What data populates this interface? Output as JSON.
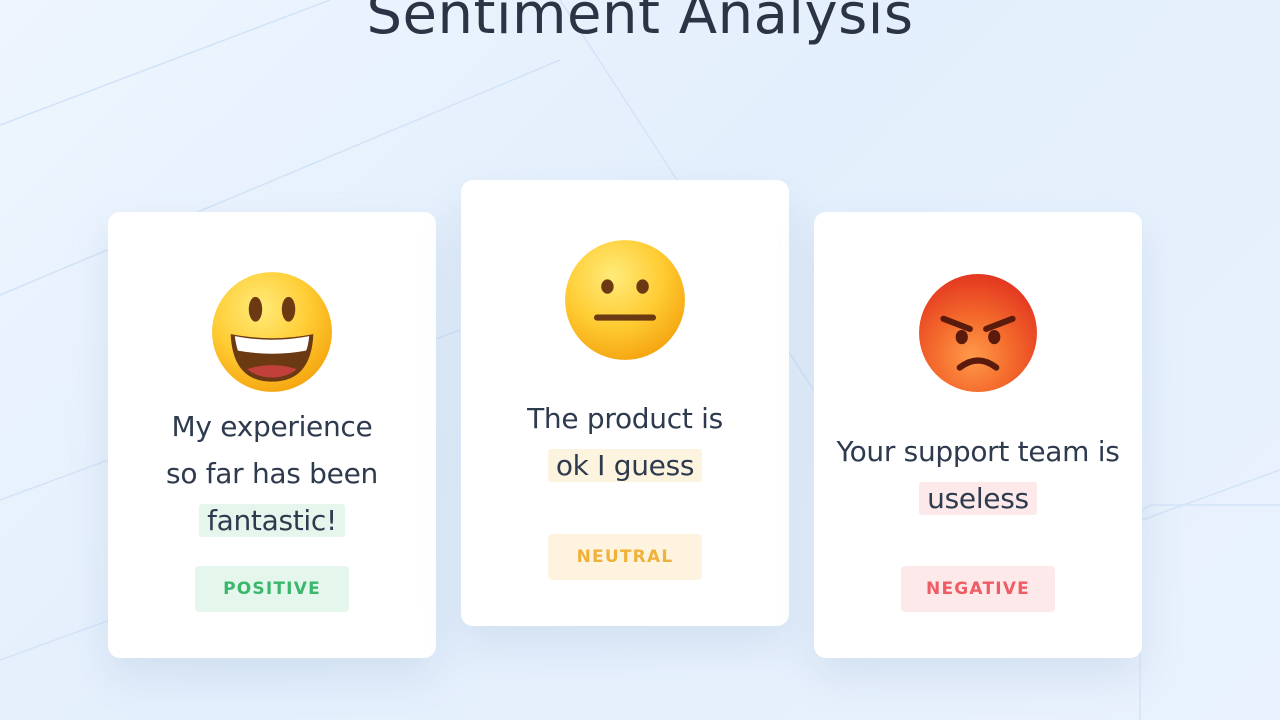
{
  "title": "Sentiment Analysis",
  "cards": [
    {
      "sentiment": "positive",
      "emoji_icon": "grinning-face-icon",
      "text_lines": [
        "My experience",
        "so far has been"
      ],
      "highlight": "fantastic!",
      "badge": "POSITIVE",
      "badge_color": "#39b86c"
    },
    {
      "sentiment": "neutral",
      "emoji_icon": "neutral-face-icon",
      "text_lines": [
        "The product is"
      ],
      "highlight": "ok I guess",
      "badge": "NEUTRAL",
      "badge_color": "#f0b13a"
    },
    {
      "sentiment": "negative",
      "emoji_icon": "angry-face-icon",
      "text_lines": [
        "Your support team is"
      ],
      "highlight": "useless",
      "badge": "NEGATIVE",
      "badge_color": "#ee5d64"
    }
  ]
}
